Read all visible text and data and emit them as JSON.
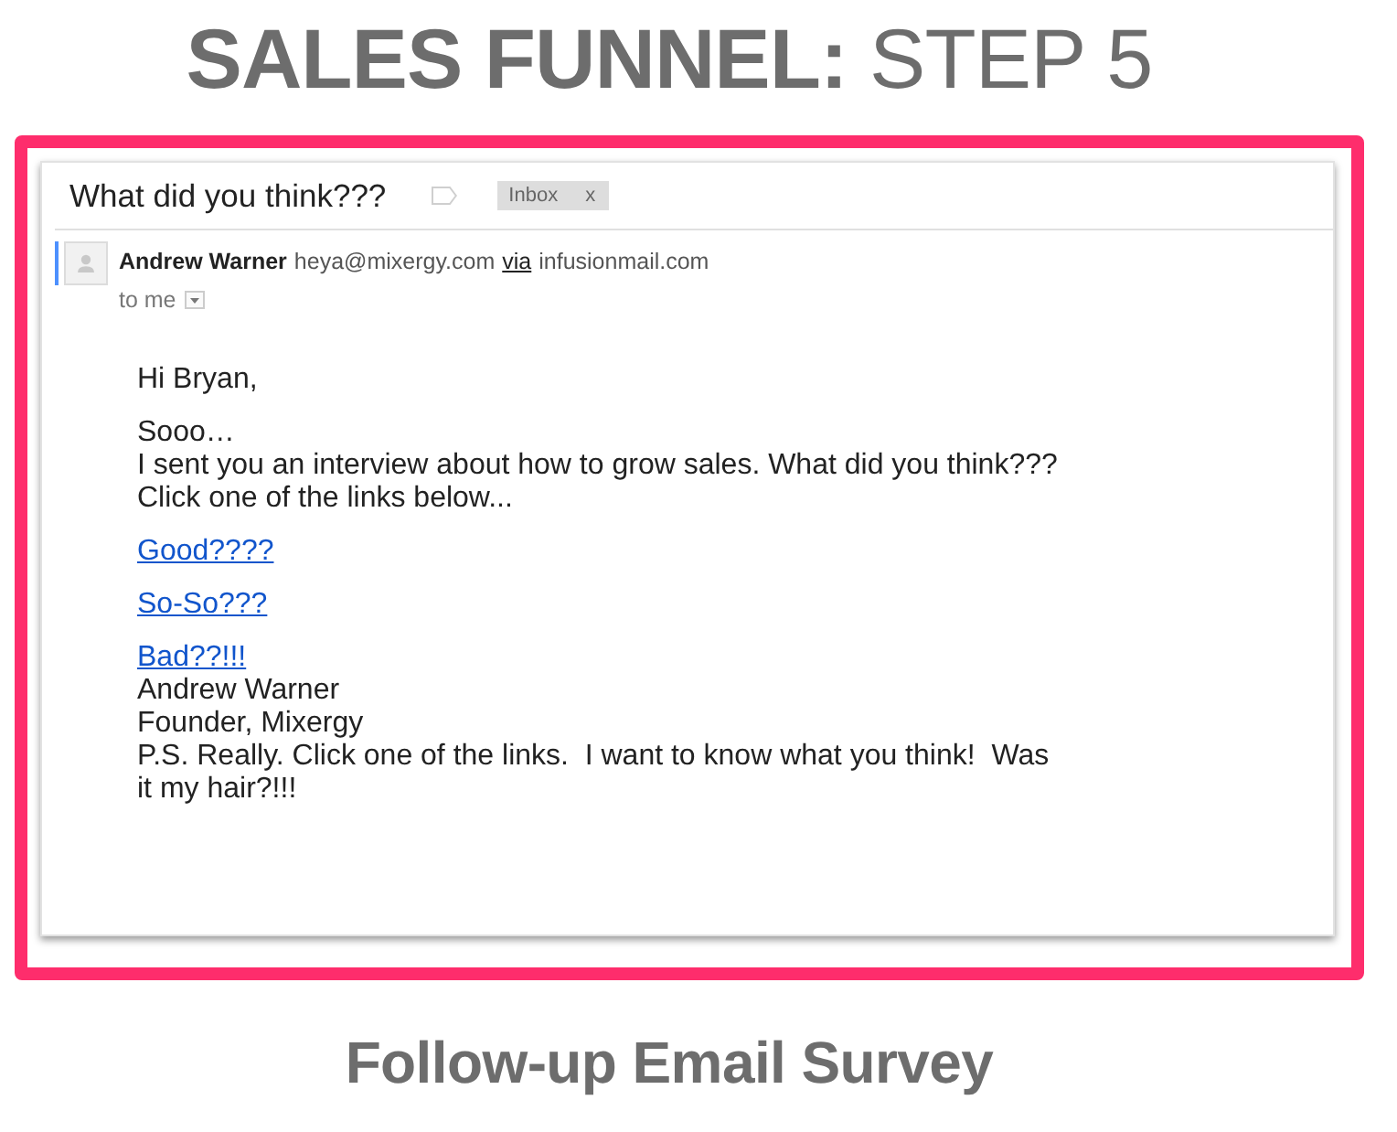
{
  "header": {
    "title": "**SALES FUNNEL:** STEP 5"
  },
  "email": {
    "subject": "What did you think???",
    "labels": [
      {
        "text": "Inbox",
        "remove": "x"
      }
    ],
    "sender": {
      "name": "Andrew Warner",
      "email": "heya@mixergy.com",
      "via": "via",
      "domain": "infusionmail.com"
    },
    "recipient": "to me",
    "body": [
      {
        "lines": [
          {
            "kind": "text",
            "text": "Hi Bryan,"
          }
        ]
      },
      {
        "lines": [
          {
            "kind": "text",
            "text": "Sooo…"
          },
          {
            "kind": "text",
            "text": "I sent you an interview about how to grow sales. What did you think???"
          },
          {
            "kind": "text",
            "text": "Click one of the links below..."
          }
        ]
      },
      {
        "lines": [
          {
            "kind": "link",
            "text": "Good????"
          }
        ]
      },
      {
        "lines": [
          {
            "kind": "link",
            "text": "So-So???"
          }
        ]
      },
      {
        "lines": [
          {
            "kind": "link",
            "text": "Bad??!!!"
          },
          {
            "kind": "text",
            "text": "Andrew Warner"
          },
          {
            "kind": "text",
            "text": "Founder, Mixergy"
          },
          {
            "kind": "text",
            "text": "P.S. Really. Click one of the links.  I want to know what you think!  Was it my hair?!!!"
          }
        ]
      }
    ]
  },
  "caption": "Follow-up Email Survey"
}
